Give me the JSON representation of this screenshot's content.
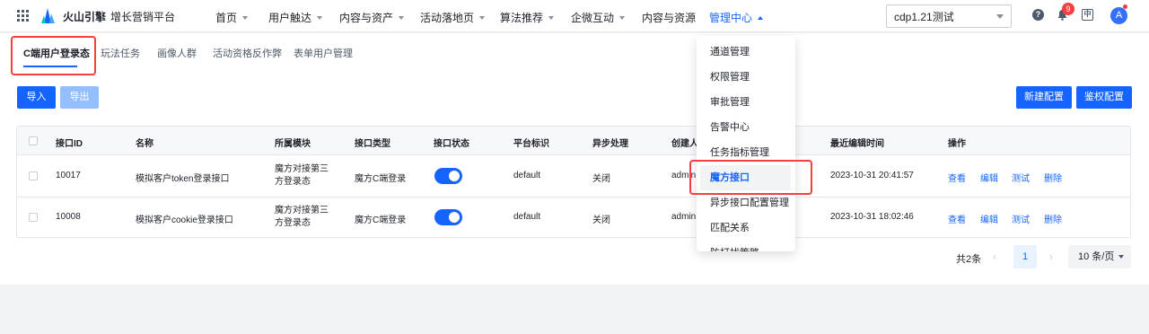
{
  "topbar": {
    "brand": "火山引擎",
    "product": "增长营销平台",
    "nav": [
      {
        "label": "首页",
        "caret": true
      },
      {
        "label": "用户触达",
        "caret": true
      },
      {
        "label": "内容与资产",
        "caret": true
      },
      {
        "label": "活动落地页",
        "caret": true
      },
      {
        "label": "算法推荐",
        "caret": true
      },
      {
        "label": "企微互动",
        "caret": true
      },
      {
        "label": "内容与资源",
        "caret": false
      },
      {
        "label": "管理中心",
        "caret": true,
        "active": true
      }
    ],
    "tenant": "cdp1.21测试",
    "notification_count": "9",
    "lang_glyph": "中",
    "avatar_initial": "A"
  },
  "tabs": [
    {
      "label": "C端用户登录态",
      "active": true
    },
    {
      "label": "玩法任务"
    },
    {
      "label": "画像人群"
    },
    {
      "label": "活动资格反作弊"
    },
    {
      "label": "表单用户管理"
    }
  ],
  "toolbar": {
    "import": "导入",
    "export": "导出",
    "create": "新建配置",
    "auth": "鉴权配置"
  },
  "table": {
    "columns": [
      "接口ID",
      "名称",
      "所属模块",
      "接口类型",
      "接口状态",
      "平台标识",
      "异步处理",
      "创建人",
      "最近编辑时间",
      "操作"
    ],
    "rows": [
      {
        "id": "10017",
        "name": "模拟客户token登录接口",
        "module": "魔方对接第三方登录态",
        "type": "魔方C端登录",
        "status_on": true,
        "platform": "default",
        "async": "关闭",
        "creator": "admin",
        "edited": "2023-10-31 20:41:57"
      },
      {
        "id": "10008",
        "name": "模拟客户cookie登录接口",
        "module": "魔方对接第三方登录态",
        "type": "魔方C端登录",
        "status_on": true,
        "platform": "default",
        "async": "关闭",
        "creator": "admin",
        "edited": "2023-10-31 18:02:46"
      }
    ],
    "actions": [
      "查看",
      "编辑",
      "测试",
      "删除"
    ]
  },
  "pagination": {
    "total": "共2条",
    "current_page": "1",
    "page_size": "10 条/页"
  },
  "dropdown": {
    "items": [
      "通道管理",
      "权限管理",
      "审批管理",
      "告警中心",
      "任务指标管理",
      "魔方接口",
      "异步接口配置管理",
      "匹配关系",
      "防打扰策略"
    ],
    "highlighted": "魔方接口"
  },
  "colors": {
    "primary": "#1664ff",
    "annotation": "#f53f3f"
  }
}
